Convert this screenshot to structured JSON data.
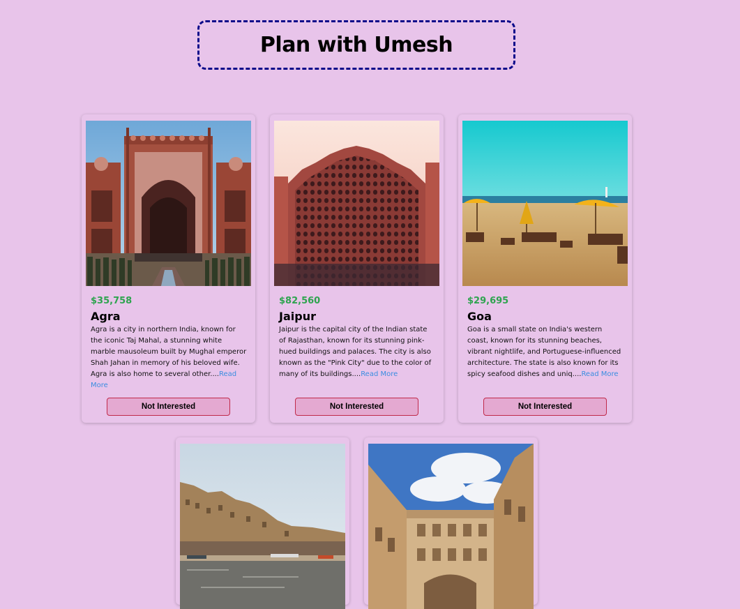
{
  "header": {
    "title": "Plan with Umesh"
  },
  "tours": [
    {
      "price": "$35,758",
      "name": "Agra",
      "description": "Agra is a city in northern India, known for the iconic Taj Mahal, a stunning white marble mausoleum built by Mughal emperor Shah Jahan in memory of his beloved wife. Agra is also home to several other....",
      "read_more": "Read More",
      "button": "Not Interested"
    },
    {
      "price": "$82,560",
      "name": "Jaipur",
      "description": "Jaipur is the capital city of the Indian state of Rajasthan, known for its stunning pink-hued buildings and palaces. The city is also known as the \"Pink City\" due to the color of many of its buildings....",
      "read_more": "Read More",
      "button": "Not Interested"
    },
    {
      "price": "$29,695",
      "name": "Goa",
      "description": "Goa is a small state on India's western coast, known for its stunning beaches, vibrant nightlife, and Portuguese-influenced architecture. The state is also known for its spicy seafood dishes and uniq....",
      "read_more": "Read More",
      "button": "Not Interested"
    }
  ],
  "colors": {
    "background": "#e8c4ea",
    "price": "#2ea44f",
    "link": "#3a8de0",
    "button_border": "#c0294a",
    "title_border": "#0b0b8a"
  }
}
